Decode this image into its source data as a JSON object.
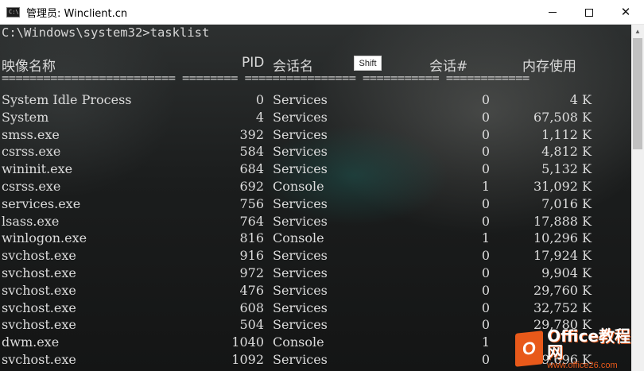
{
  "window": {
    "title": "管理员: Winclient.cn",
    "icon": "console-icon",
    "icon_glyph": "C:\\",
    "controls": {
      "minimize": "minimize-icon",
      "maximize": "maximize-icon",
      "close": "close-icon",
      "close_glyph": "✕"
    }
  },
  "console": {
    "prompt": "C:\\Windows\\system32>tasklist",
    "headers": {
      "name": "映像名称",
      "pid": "PID",
      "session_name": "会话名",
      "session_num": "会话#",
      "mem": "内存使用"
    },
    "separator": "========================= ======== ================ =========== ============",
    "rows": [
      {
        "name": "System Idle Process",
        "pid": "0",
        "session": "Services",
        "num": "0",
        "mem": "4 K"
      },
      {
        "name": "System",
        "pid": "4",
        "session": "Services",
        "num": "0",
        "mem": "67,508 K"
      },
      {
        "name": "smss.exe",
        "pid": "392",
        "session": "Services",
        "num": "0",
        "mem": "1,112 K"
      },
      {
        "name": "csrss.exe",
        "pid": "584",
        "session": "Services",
        "num": "0",
        "mem": "4,812 K"
      },
      {
        "name": "wininit.exe",
        "pid": "684",
        "session": "Services",
        "num": "0",
        "mem": "5,132 K"
      },
      {
        "name": "csrss.exe",
        "pid": "692",
        "session": "Console",
        "num": "1",
        "mem": "31,092 K"
      },
      {
        "name": "services.exe",
        "pid": "756",
        "session": "Services",
        "num": "0",
        "mem": "7,016 K"
      },
      {
        "name": "lsass.exe",
        "pid": "764",
        "session": "Services",
        "num": "0",
        "mem": "17,888 K"
      },
      {
        "name": "winlogon.exe",
        "pid": "816",
        "session": "Console",
        "num": "1",
        "mem": "10,296 K"
      },
      {
        "name": "svchost.exe",
        "pid": "916",
        "session": "Services",
        "num": "0",
        "mem": "17,924 K"
      },
      {
        "name": "svchost.exe",
        "pid": "972",
        "session": "Services",
        "num": "0",
        "mem": "9,904 K"
      },
      {
        "name": "svchost.exe",
        "pid": "476",
        "session": "Services",
        "num": "0",
        "mem": "29,760 K"
      },
      {
        "name": "svchost.exe",
        "pid": "608",
        "session": "Services",
        "num": "0",
        "mem": "32,752 K"
      },
      {
        "name": "svchost.exe",
        "pid": "504",
        "session": "Services",
        "num": "0",
        "mem": "29,780 K"
      },
      {
        "name": "dwm.exe",
        "pid": "1040",
        "session": "Console",
        "num": "1",
        "mem": ""
      },
      {
        "name": "svchost.exe",
        "pid": "1092",
        "session": "Services",
        "num": "0",
        "mem": "9,696 K"
      }
    ]
  },
  "tooltip": {
    "text": "Shift"
  },
  "scrollbar": {
    "up_arrow": "▲"
  },
  "watermark": {
    "logo_letter": "O",
    "title": "Office教程网",
    "url": "www.office26.com",
    "color": "#e8591a"
  }
}
